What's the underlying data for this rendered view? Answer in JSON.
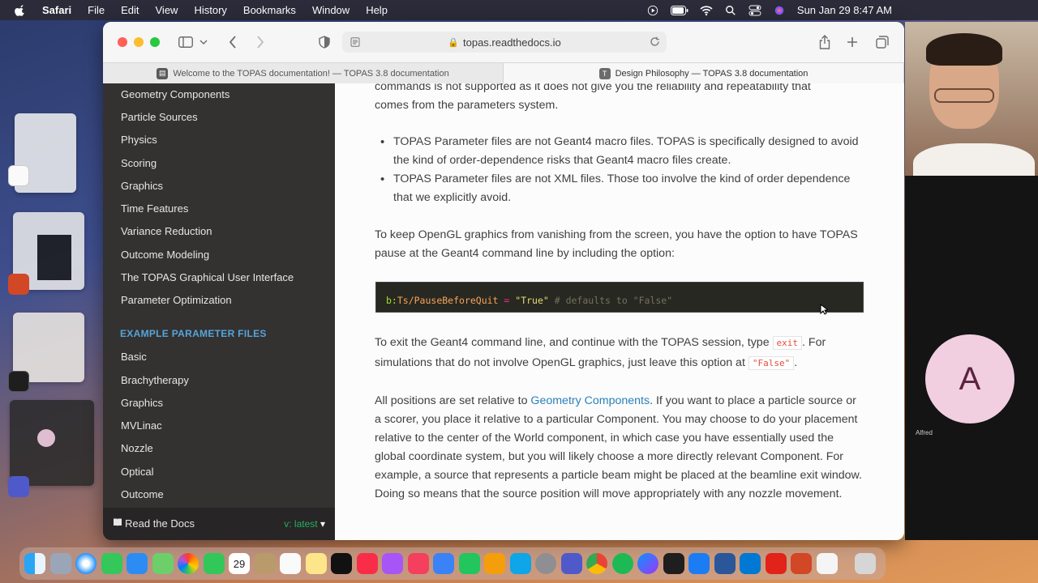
{
  "menubar": {
    "app_name": "Safari",
    "items": [
      "File",
      "Edit",
      "View",
      "History",
      "Bookmarks",
      "Window",
      "Help"
    ],
    "clock": "Sun Jan 29  8:47 AM"
  },
  "browser": {
    "url": "topas.readthedocs.io",
    "tabs": [
      {
        "title": "Welcome to the TOPAS documentation! — TOPAS 3.8 documentation",
        "active": false
      },
      {
        "title": "Design Philosophy — TOPAS 3.8 documentation",
        "active": true
      }
    ]
  },
  "sidebar": {
    "items": [
      "Geometry Components",
      "Particle Sources",
      "Physics",
      "Scoring",
      "Graphics",
      "Time Features",
      "Variance Reduction",
      "Outcome Modeling",
      "The TOPAS Graphical User Interface",
      "Parameter Optimization"
    ],
    "section_heading": "EXAMPLE PARAMETER FILES",
    "example_items": [
      "Basic",
      "Brachytherapy",
      "Graphics",
      "MVLinac",
      "Nozzle",
      "Optical",
      "Outcome"
    ],
    "footer_label": "Read the Docs",
    "footer_version": "v: latest"
  },
  "content": {
    "intro_line1": "commands is not supported as it does not give you the reliability and repeatability that",
    "intro_line2": "comes from the parameters system.",
    "bullet1": "TOPAS Parameter files are not Geant4 macro files. TOPAS is specifically designed to avoid the kind of order-dependence risks that Geant4 macro files create.",
    "bullet2": "TOPAS Parameter files are not XML files. Those too involve the kind of order dependence that we explicitly avoid.",
    "opengl_para": "To keep OpenGL graphics from vanishing from the screen, you have the option to have TOPAS pause at the Geant4 command line by including the option:",
    "code": {
      "prefix": "b:",
      "param": "Ts/PauseBeforeQuit",
      "equals": " = ",
      "value": "\"True\"",
      "comment": " # defaults to \"False\""
    },
    "exit_para_start": "To exit the Geant4 command line, and continue with the TOPAS session, type ",
    "exit_code": "exit",
    "exit_para_mid": ". For simulations that do not involve OpenGL graphics, just leave this option at ",
    "false_code": "\"False\"",
    "exit_para_end": ".",
    "positions_start": "All positions are set relative to ",
    "positions_link": "Geometry Components",
    "positions_rest": ". If you want to place a particle source or a scorer, you place it relative to a particular Component. You may choose to do your placement relative to the center of the World component, in which case you have essentially used the global coordinate system, but you will likely choose a more directly relevant Component. For example, a source that represents a particle beam might be placed at the beamline exit window. Doing so means that the source position will move appropriately with any nozzle movement."
  },
  "meeting": {
    "avatar_letter": "A",
    "participant_name": "Alfred"
  },
  "dock": {
    "calendar_day": "29"
  },
  "colors": {
    "sidebar_bg": "#343131",
    "section_heading": "#55a5d9",
    "link": "#2980b9",
    "version_green": "#27ae60",
    "code_bg": "#272822"
  }
}
